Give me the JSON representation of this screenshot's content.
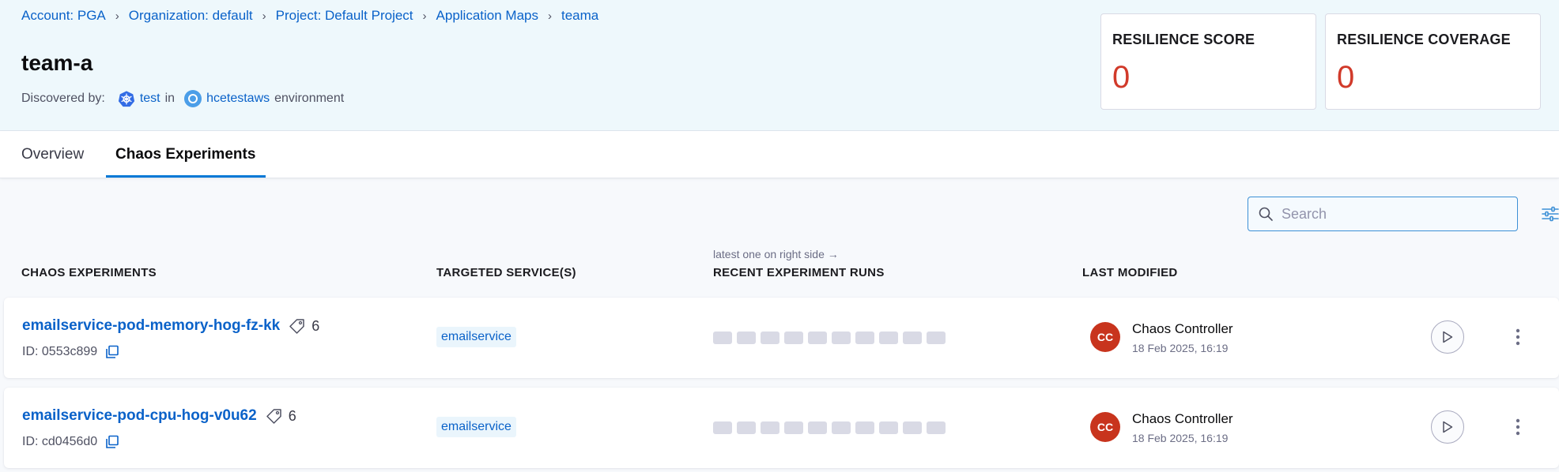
{
  "breadcrumb": [
    {
      "label": "Account: PGA"
    },
    {
      "label": "Organization: default"
    },
    {
      "label": "Project: Default Project"
    },
    {
      "label": "Application Maps"
    },
    {
      "label": "teama"
    }
  ],
  "page": {
    "title": "team-a",
    "discovered_by_label": "Discovered by:",
    "discovered_agent": "test",
    "in_label": "in",
    "environment_name": "hcetestaws",
    "environment_label": "environment"
  },
  "scores": {
    "resilience_score": {
      "label": "RESILIENCE SCORE",
      "value": "0"
    },
    "resilience_coverage": {
      "label": "RESILIENCE COVERAGE",
      "value": "0"
    }
  },
  "tabs": [
    {
      "label": "Overview",
      "active": false
    },
    {
      "label": "Chaos Experiments",
      "active": true
    }
  ],
  "search": {
    "placeholder": "Search",
    "value": ""
  },
  "table": {
    "hint": "latest one on right side →",
    "columns": {
      "experiments": "CHAOS EXPERIMENTS",
      "services": "TARGETED SERVICE(S)",
      "runs": "RECENT EXPERIMENT RUNS",
      "modified": "LAST MODIFIED"
    },
    "rows": [
      {
        "name": "emailservice-pod-memory-hog-fz-kk",
        "tag_count": "6",
        "id": "ID: 0553c899",
        "service": "emailservice",
        "runs": 10,
        "avatar_initials": "CC",
        "modified_by": "Chaos Controller",
        "modified_at": "18 Feb 2025, 16:19"
      },
      {
        "name": "emailservice-pod-cpu-hog-v0u62",
        "tag_count": "6",
        "id": "ID: cd0456d0",
        "service": "emailservice",
        "runs": 10,
        "avatar_initials": "CC",
        "modified_by": "Chaos Controller",
        "modified_at": "18 Feb 2025, 16:19"
      }
    ]
  },
  "colors": {
    "link": "#0a62c9",
    "score_value": "#d13a2a",
    "avatar_bg": "#c8341d",
    "header_bg": "#eef8fc",
    "tab_active_underline": "#0278d5"
  },
  "icons": [
    "chevron-right-icon",
    "kubernetes-icon",
    "environment-icon",
    "search-icon",
    "filter-icon",
    "tag-icon",
    "copy-icon",
    "play-icon",
    "more-vertical-icon"
  ]
}
